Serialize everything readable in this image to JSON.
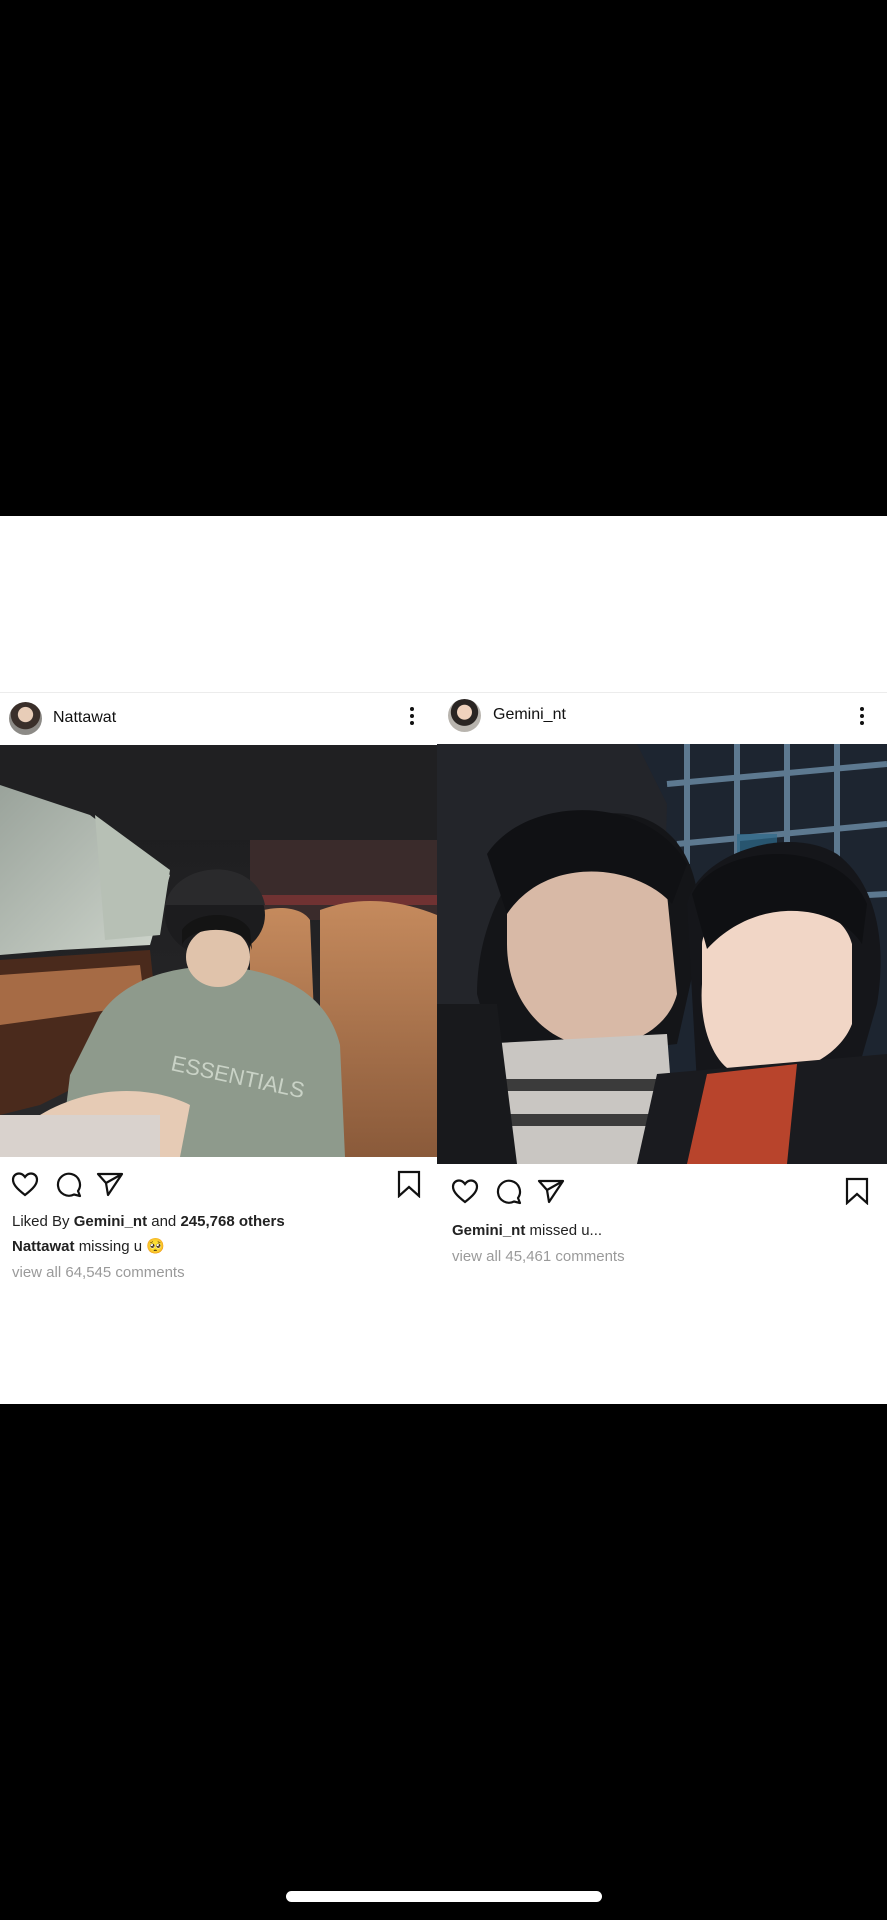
{
  "posts": [
    {
      "username": "Nattawat",
      "liked_by_prefix": "Liked By",
      "liked_by_user": "Gemini_nt",
      "liked_by_and": "and",
      "liked_by_count": "245,768 others",
      "caption_user": "Nattawat",
      "caption_text": "missing u 🥺",
      "comments_link": "view all 64,545 comments",
      "photo_text": "ESSENTIALS"
    },
    {
      "username": "Gemini_nt",
      "caption_user": "Gemini_nt",
      "caption_text": "missed u...",
      "comments_link": "view all 45,461 comments"
    }
  ]
}
